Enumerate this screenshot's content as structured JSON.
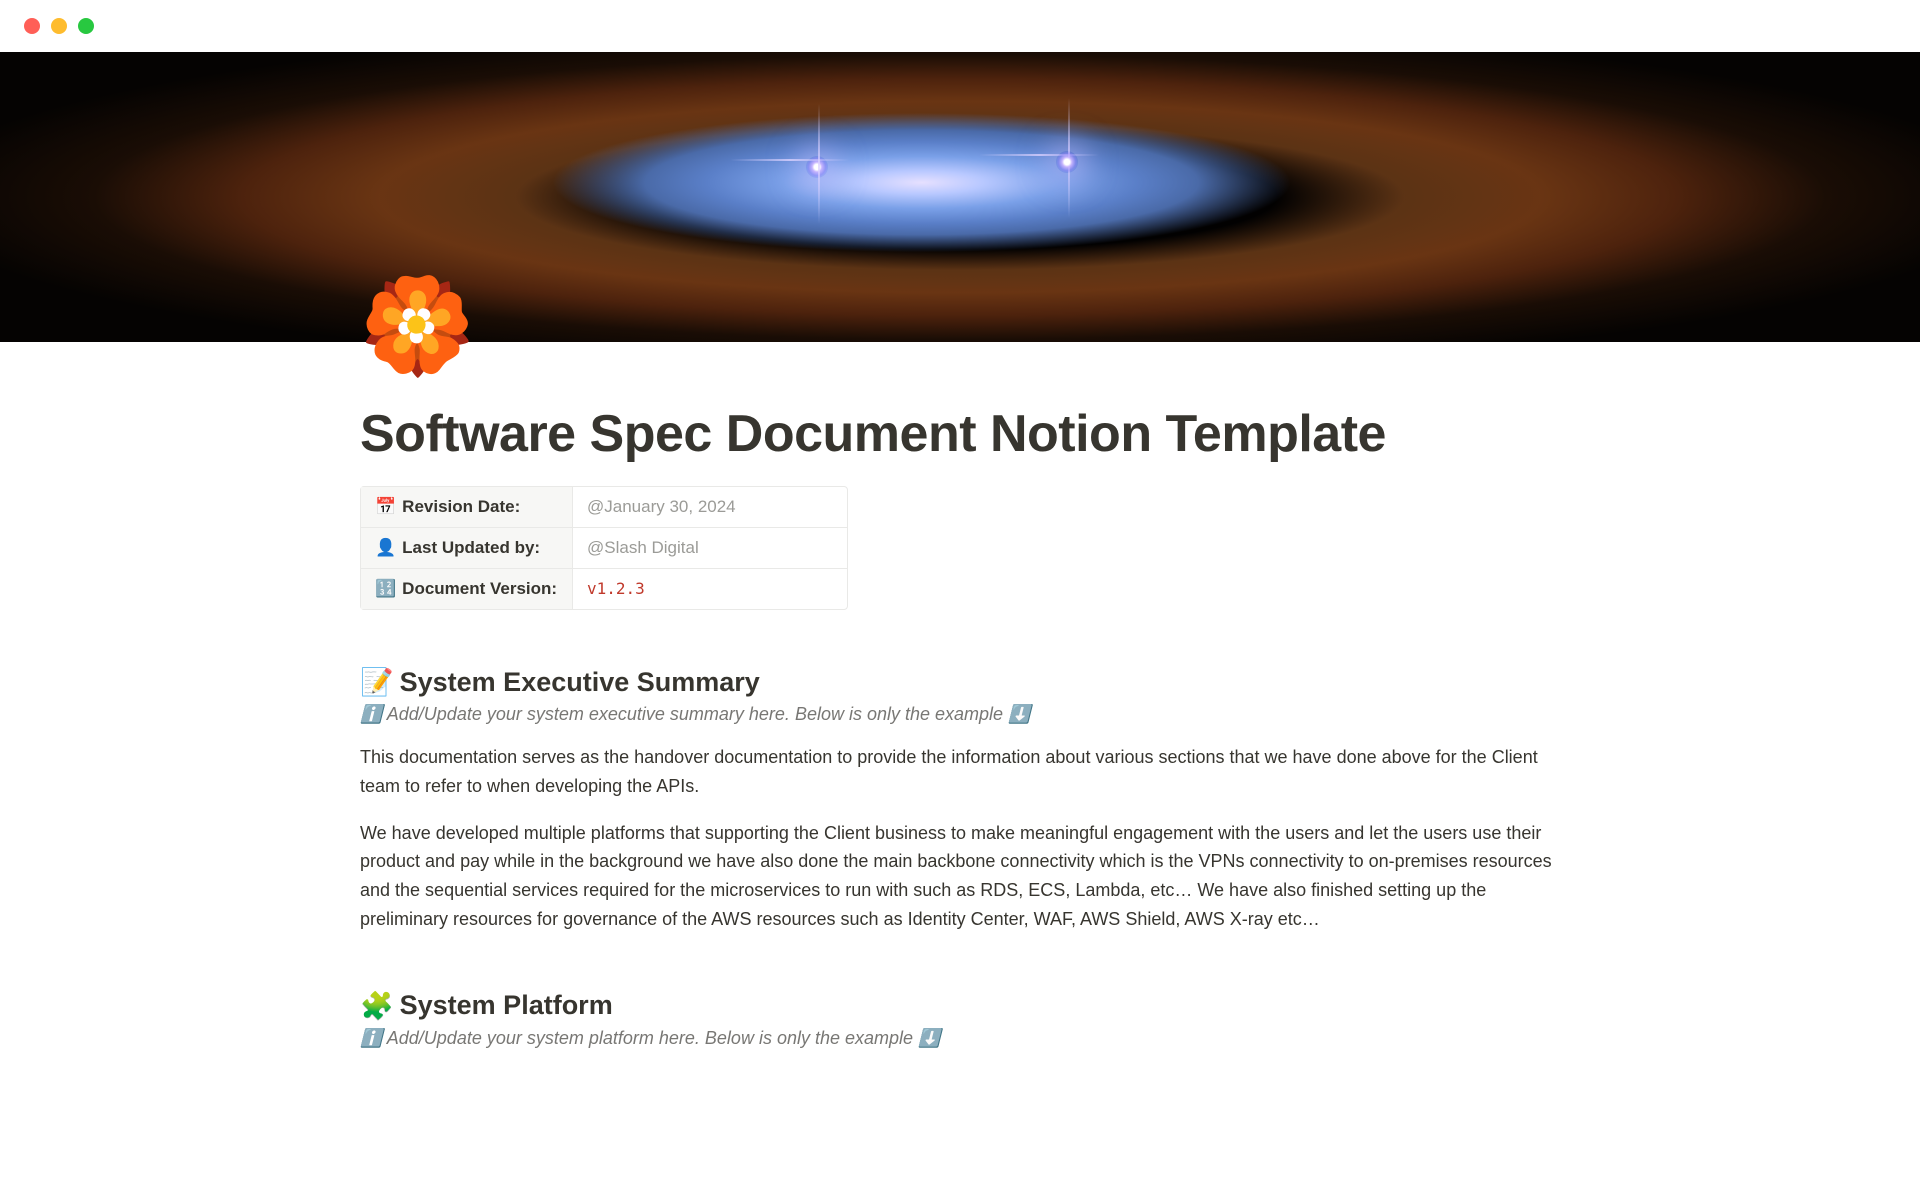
{
  "page": {
    "icon": "🏵️",
    "title": "Software Spec Document Notion Template"
  },
  "meta": {
    "rows": [
      {
        "icon": "📅",
        "label": "Revision Date:",
        "value": "@January 30, 2024",
        "type": "mention"
      },
      {
        "icon": "👤",
        "label": "Last Updated by:",
        "value": "@Slash Digital",
        "type": "mention"
      },
      {
        "icon": "🔢",
        "label": "Document Version:",
        "value": "v1.2.3",
        "type": "code"
      }
    ]
  },
  "sections": {
    "summary": {
      "icon": "📝",
      "heading": "System Executive Summary",
      "hint_prefix": "ℹ️",
      "hint": "Add/Update your system executive summary here. Below is only the example",
      "hint_suffix": "⬇️",
      "paragraphs": [
        "This documentation serves as the handover documentation to provide the information about various sections that we have done above for the Client team to refer to when developing the APIs.",
        "We have developed multiple platforms that supporting the Client business to make meaningful engagement with the users and let the users use their product and pay while in the background we have also done the main backbone connectivity which is the VPNs connectivity to on-premises resources and the sequential services required for the microservices to run with such as RDS, ECS, Lambda, etc… We have also finished setting up the preliminary resources for governance of the AWS resources such as Identity Center, WAF, AWS Shield, AWS X-ray etc…"
      ]
    },
    "platform": {
      "icon": "🧩",
      "heading": "System Platform",
      "hint_prefix": "ℹ️",
      "hint": "Add/Update your system platform here. Below is only the example",
      "hint_suffix": "⬇️"
    }
  }
}
